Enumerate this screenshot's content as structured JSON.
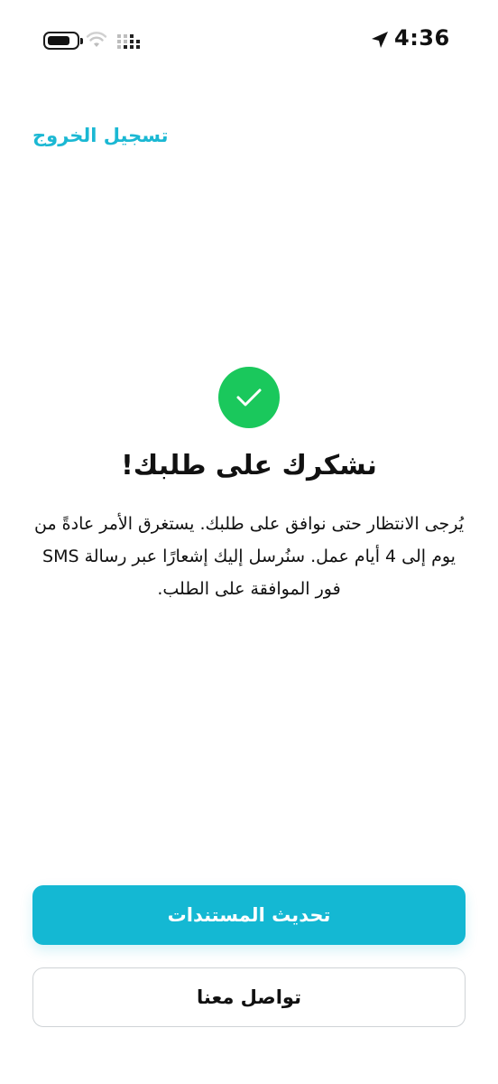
{
  "status_bar": {
    "time": "4:36",
    "icons": [
      "battery-icon",
      "wifi-icon",
      "signal-icon",
      "location-arrow-icon"
    ]
  },
  "header": {
    "logout_label": "تسجيل الخروج"
  },
  "main": {
    "success_icon": "checkmark-icon",
    "title": "نشكرك على طلبك!",
    "description": "يُرجى الانتظار حتى نوافق على طلبك. يستغرق الأمر عادةً من يوم إلى 4 أيام عمل. سنُرسل إليك إشعارًا عبر رسالة SMS فور الموافقة على الطلب."
  },
  "actions": {
    "update_documents_label": "تحديث المستندات",
    "contact_us_label": "تواصل معنا"
  },
  "colors": {
    "accent": "#14b8d3",
    "success": "#1ac85c",
    "link": "#1bb8d3"
  }
}
